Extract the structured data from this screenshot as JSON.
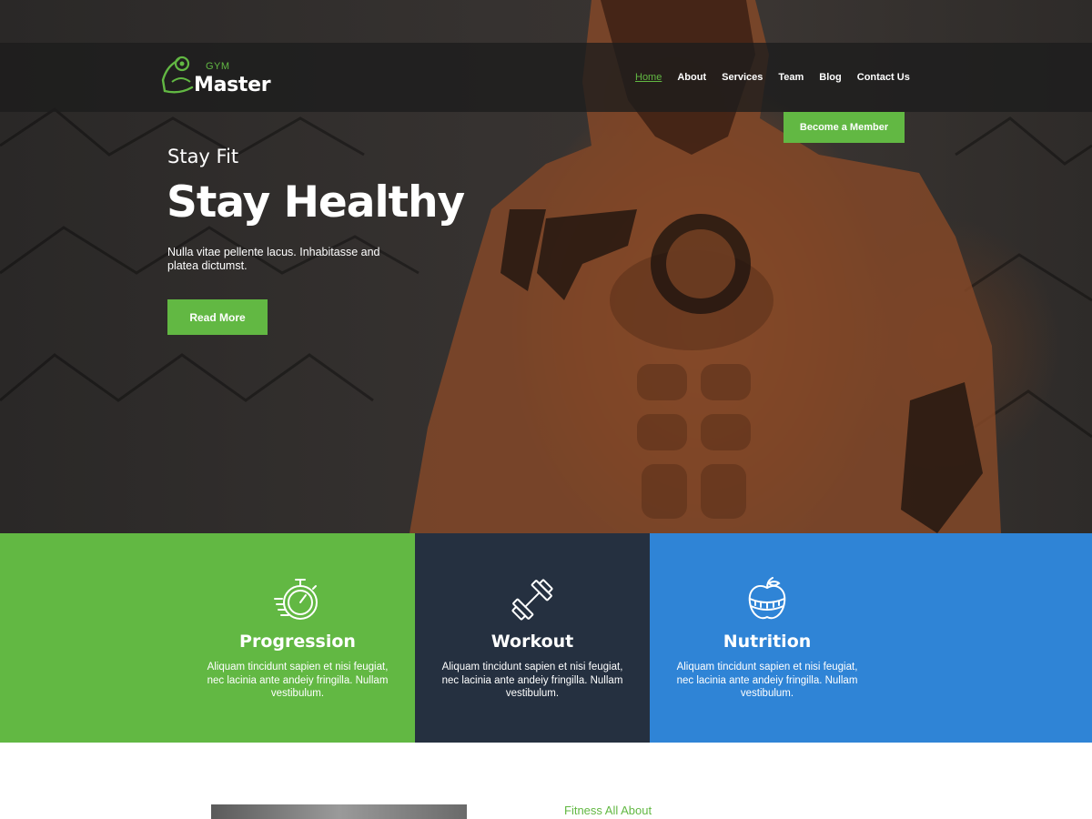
{
  "brand": {
    "small": "GYM",
    "main": "Master"
  },
  "nav": {
    "items": [
      {
        "label": "Home",
        "active": true
      },
      {
        "label": "About"
      },
      {
        "label": "Services"
      },
      {
        "label": "Team"
      },
      {
        "label": "Blog"
      },
      {
        "label": "Contact Us"
      }
    ],
    "cta": "Become a Member"
  },
  "hero": {
    "subtitle": "Stay Fit",
    "title": "Stay Healthy",
    "description": "Nulla vitae pellente lacus. Inhabitasse and platea dictumst.",
    "button": "Read More"
  },
  "features": [
    {
      "icon": "stopwatch-icon",
      "title": "Progression",
      "text": "Aliquam tincidunt sapien et nisi feugiat, nec lacinia ante andeiy fringilla. Nullam vestibulum.",
      "color": "#62b843"
    },
    {
      "icon": "dumbbell-icon",
      "title": "Workout",
      "text": "Aliquam tincidunt sapien et nisi feugiat, nec lacinia ante andeiy fringilla. Nullam vestibulum.",
      "color": "#253040"
    },
    {
      "icon": "apple-measure-icon",
      "title": "Nutrition",
      "text": "Aliquam tincidunt sapien et nisi feugiat, nec lacinia ante andeiy fringilla. Nullam vestibulum.",
      "color": "#2f84d6"
    }
  ],
  "about": {
    "label": "Fitness All About"
  },
  "colors": {
    "accent": "#62b843",
    "dark": "#253040",
    "blue": "#2f84d6"
  }
}
